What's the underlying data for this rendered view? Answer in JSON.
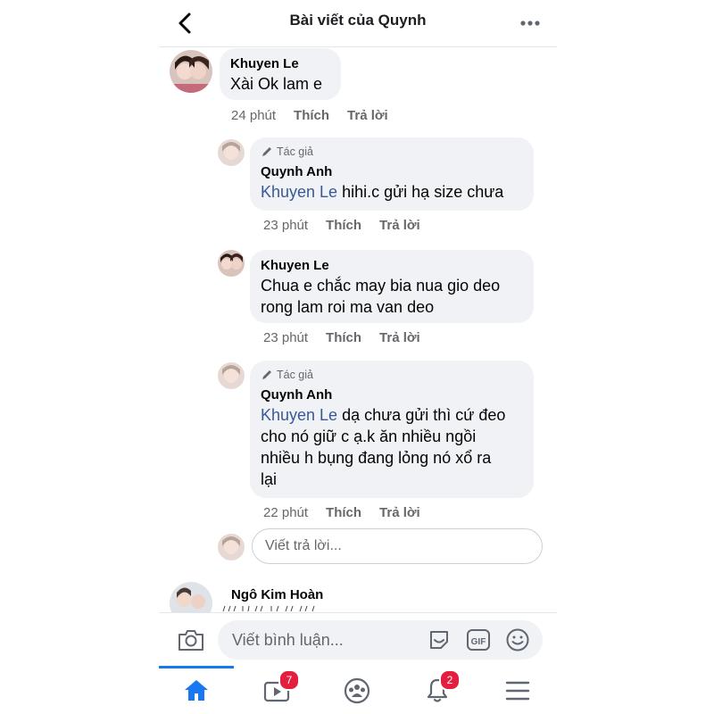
{
  "header": {
    "title": "Bài viết của Quynh"
  },
  "comments": [
    {
      "name": "Khuyen Le",
      "text": "Xài Ok lam e",
      "time": "24 phút",
      "like": "Thích",
      "reply": "Trả lời"
    },
    {
      "author_tag": "Tác giả",
      "name": "Quynh Anh",
      "mention": "Khuyen Le",
      "text": "hihi.c gửi hạ size chưa",
      "time": "23 phút",
      "like": "Thích",
      "reply": "Trả lời"
    },
    {
      "name": "Khuyen Le",
      "line1": "Chua e chắc may bia nua gio deo",
      "line2": "rong lam roi ma van deo",
      "time": "23 phút",
      "like": "Thích",
      "reply": "Trả lời"
    },
    {
      "author_tag": "Tác giả",
      "name": "Quynh Anh",
      "mention": "Khuyen Le",
      "line1": "dạ chưa gửi thì cứ đeo",
      "line2": "cho nó giữ c ạ.k ăn nhiều ngồi",
      "line3": "nhiều h bụng đang lỏng nó xổ ra",
      "line4": "lại",
      "time": "22 phút",
      "like": "Thích",
      "reply": "Trả lời"
    },
    {
      "name": "Ngô Kim Hoàn"
    }
  ],
  "reply_box": {
    "placeholder": "Viết trả lời..."
  },
  "composer": {
    "placeholder": "Viết bình luận..."
  },
  "nav": {
    "watch_badge": "7",
    "notifications_badge": "2"
  },
  "colors": {
    "accent": "#1877f2",
    "mention": "#385898",
    "badge": "#e41e3f"
  }
}
